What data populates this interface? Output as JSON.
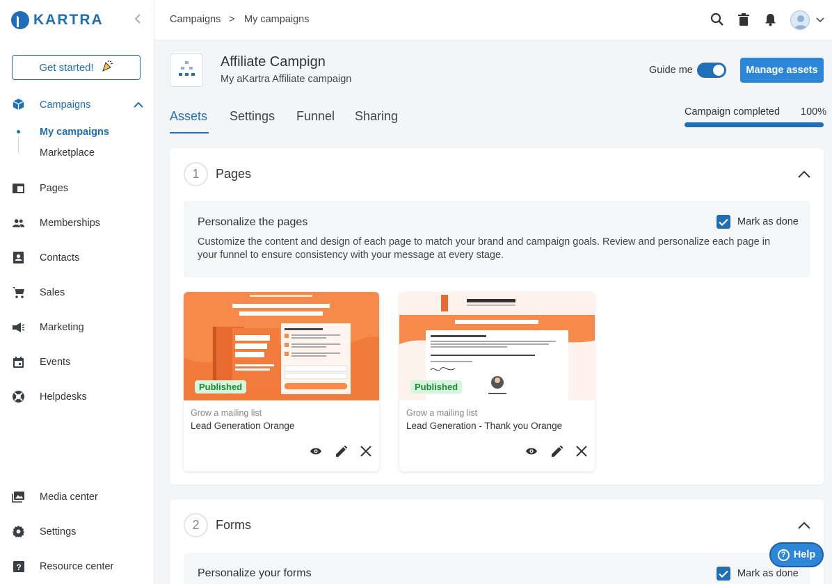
{
  "brand": {
    "name": "KARTRA",
    "accent": "#1e6fb7",
    "button": "#2d86d8"
  },
  "sidebar": {
    "get_started": "Get started!",
    "campaigns": "Campaigns",
    "sub": {
      "my_campaigns": "My campaigns",
      "marketplace": "Marketplace"
    },
    "items": [
      {
        "label": "Pages",
        "icon": "pages-icon"
      },
      {
        "label": "Memberships",
        "icon": "memberships-icon"
      },
      {
        "label": "Contacts",
        "icon": "contacts-icon"
      },
      {
        "label": "Sales",
        "icon": "cart-icon"
      },
      {
        "label": "Marketing",
        "icon": "megaphone-icon"
      },
      {
        "label": "Events",
        "icon": "calendar-icon"
      },
      {
        "label": "Helpdesks",
        "icon": "lifebuoy-icon"
      }
    ],
    "bottom": [
      {
        "label": "Media center",
        "icon": "media-icon"
      },
      {
        "label": "Settings",
        "icon": "gear-icon"
      },
      {
        "label": "Resource center",
        "icon": "help-square-icon"
      }
    ]
  },
  "breadcrumb": {
    "root": "Campaigns",
    "sep": ">",
    "current": "My campaigns"
  },
  "campaign": {
    "title": "Affiliate Campign",
    "subtitle": "My aKartra Affiliate campaign",
    "guide_me": "Guide me",
    "guide_on": true,
    "manage_assets": "Manage assets"
  },
  "tabs": [
    "Assets",
    "Settings",
    "Funnel",
    "Sharing"
  ],
  "active_tab": "Assets",
  "progress": {
    "label": "Campaign completed",
    "percent_text": "100%",
    "value": 1.0
  },
  "sections": {
    "pages": {
      "number": "1",
      "title": "Pages",
      "info_title": "Personalize the pages",
      "info_desc": "Customize the content and design of each page to match your brand and campaign goals. Review and personalize each page in your funnel to ensure consistency with your message at every stage.",
      "mark_done": "Mark as done",
      "cards": [
        {
          "badge": "Published",
          "category": "Grow a mailing list",
          "name": "Lead Generation Orange"
        },
        {
          "badge": "Published",
          "category": "Grow a mailing list",
          "name": "Lead Generation - Thank you Orange"
        }
      ]
    },
    "forms": {
      "number": "2",
      "title": "Forms",
      "info_title": "Personalize your forms",
      "mark_done": "Mark as done"
    }
  },
  "help": "Help"
}
